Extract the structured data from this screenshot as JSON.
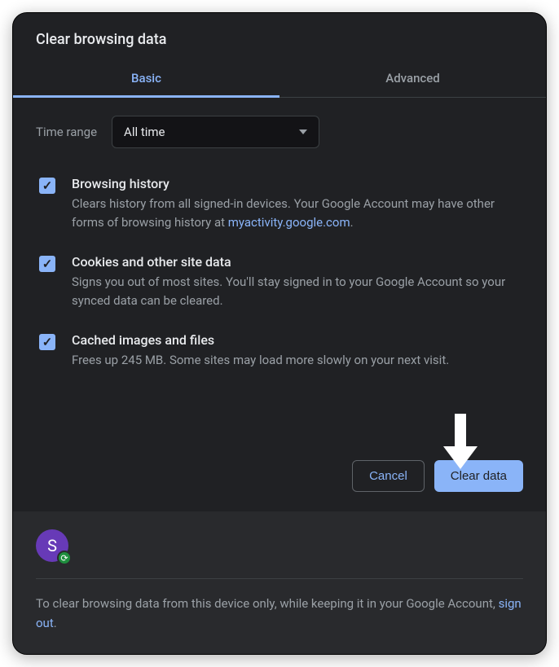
{
  "title": "Clear browsing data",
  "tabs": {
    "basic": "Basic",
    "advanced": "Advanced"
  },
  "timeRange": {
    "label": "Time range",
    "value": "All time"
  },
  "options": [
    {
      "title": "Browsing history",
      "descPrefix": "Clears history from all signed-in devices. Your Google Account may have other forms of browsing history at ",
      "link": "myactivity.google.com",
      "descSuffix": "."
    },
    {
      "title": "Cookies and other site data",
      "desc": "Signs you out of most sites. You'll stay signed in to your Google Account so your synced data can be cleared."
    },
    {
      "title": "Cached images and files",
      "desc": "Frees up 245 MB. Some sites may load more slowly on your next visit."
    }
  ],
  "buttons": {
    "cancel": "Cancel",
    "clear": "Clear data"
  },
  "footer": {
    "avatarLetter": "S",
    "textPrefix": "To clear browsing data from this device only, while keeping it in your Google Account, ",
    "link": "sign out",
    "textSuffix": "."
  }
}
